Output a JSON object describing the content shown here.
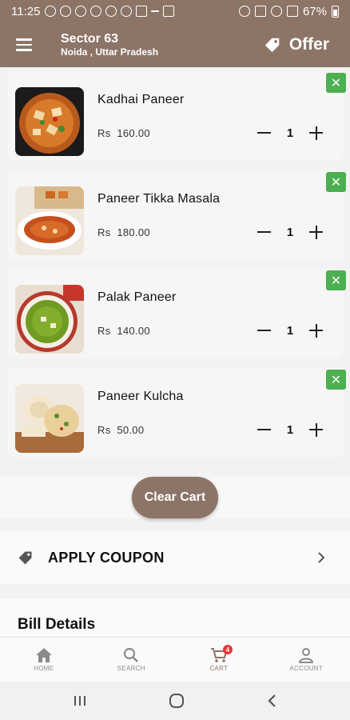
{
  "status_bar": {
    "time": "11:25",
    "battery": "67%"
  },
  "header": {
    "location_title": "Sector 63",
    "location_subtitle": "Noida , Uttar Pradesh",
    "offer_label": "Offer",
    "colors": {
      "primary": "#8c7467"
    }
  },
  "cart": {
    "currency": "Rs",
    "items": [
      {
        "name": "Kadhai Paneer",
        "price": "160.00",
        "qty": "1",
        "image": "kadhai-paneer-image"
      },
      {
        "name": "Paneer Tikka Masala",
        "price": "180.00",
        "qty": "1",
        "image": "paneer-tikka-masala-image"
      },
      {
        "name": "Palak Paneer",
        "price": "140.00",
        "qty": "1",
        "image": "palak-paneer-image"
      },
      {
        "name": "Paneer Kulcha",
        "price": "50.00",
        "qty": "1",
        "image": "paneer-kulcha-image"
      }
    ],
    "clear_label": "Clear Cart",
    "remove_color": "#4caf50"
  },
  "coupon": {
    "label": "APPLY COUPON"
  },
  "bill": {
    "title": "Bill Details"
  },
  "bottom_nav": {
    "items": [
      {
        "label": "HOME",
        "icon": "home-icon"
      },
      {
        "label": "SEARCH",
        "icon": "search-icon"
      },
      {
        "label": "CART",
        "icon": "cart-icon",
        "badge": "4"
      },
      {
        "label": "ACCOUNT",
        "icon": "account-icon"
      }
    ]
  }
}
